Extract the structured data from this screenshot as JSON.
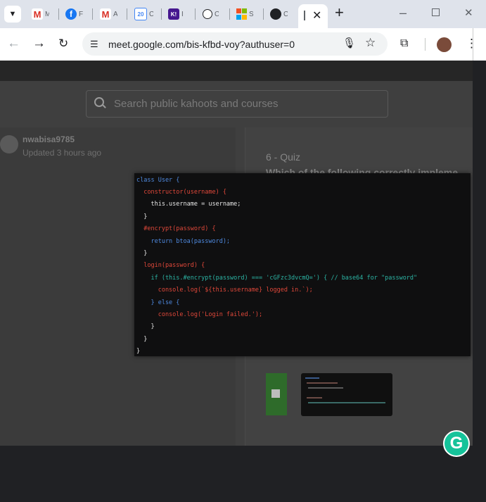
{
  "browser": {
    "tabs": [
      {
        "icon": "gmail-icon",
        "label": "M"
      },
      {
        "icon": "facebook-icon",
        "label": "F"
      },
      {
        "icon": "gmail-icon",
        "label": "A"
      },
      {
        "icon": "calendar-icon",
        "label": "C",
        "badge": "20"
      },
      {
        "icon": "kahoot-icon",
        "label": "I",
        "badge": "K!"
      },
      {
        "icon": "chatgpt-icon",
        "label": "C"
      },
      {
        "icon": "microsoft-icon",
        "label": "S"
      },
      {
        "icon": "github-icon",
        "label": "C"
      },
      {
        "icon": "meet-icon",
        "label": "",
        "active": true
      }
    ],
    "url": "meet.google.com/bis-kfbd-voy?authuser=0"
  },
  "page": {
    "search_placeholder": "Search public kahoots and courses",
    "author": "nwabisa9785",
    "updated": "Updated 3 hours ago",
    "quiz_label": "6 - Quiz",
    "question": "Which of the following correctly impleme"
  },
  "code_lines": [
    "class User {",
    "  constructor(username) {",
    "    this.username = username;",
    "  }",
    "  #encrypt(password) {",
    "    return btoa(password);",
    "  }",
    "  login(password) {",
    "    if (this.#encrypt(password) === 'cGFzc3dvcmQ=') { // base64 for \"password\"",
    "      console.log(`${this.username} logged in.`);",
    "    } else {",
    "      console.log('Login failed.');",
    "    }",
    "  }",
    "}"
  ],
  "colors": {
    "accent_green": "#2e9e2e",
    "accent_yellow": "#c9a515",
    "grammarly": "#15c39a"
  }
}
